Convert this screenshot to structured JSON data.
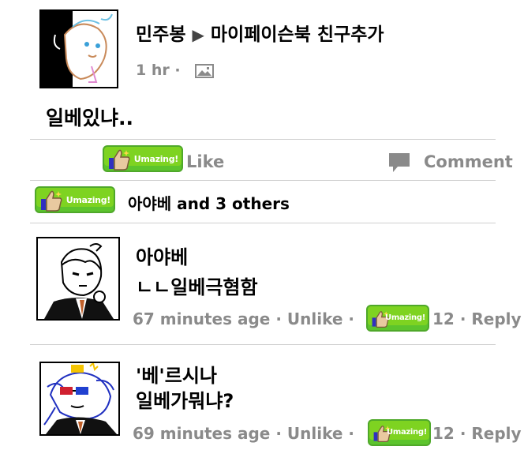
{
  "post": {
    "author": "민주봉",
    "arrow": "▶",
    "target": "마이페이슨북 친구추가",
    "time": "1 hr",
    "separator": "·",
    "body": "일베있냐..",
    "like_label": "Like",
    "comment_label": "Comment",
    "badge_text": "Umazing!"
  },
  "likes_summary": {
    "text": "아야베 and 3 others"
  },
  "comments": [
    {
      "author": "아야베",
      "text": "ㄴㄴ일베극혐함",
      "time": "67 minutes age",
      "unlike": "Unlike",
      "count": "12",
      "reply": "Reply"
    },
    {
      "author": "'베'르시나",
      "text": "일베가뭐냐?",
      "time": "69 minutes age",
      "unlike": "Unlike",
      "count": "12",
      "reply": "Reply"
    }
  ],
  "colors": {
    "badge_green": "#7ed321",
    "divider": "#cfcfcf",
    "meta_gray": "#8a8a8a"
  },
  "icons": [
    "photo-icon",
    "thumbs-up-icon",
    "comment-icon"
  ]
}
